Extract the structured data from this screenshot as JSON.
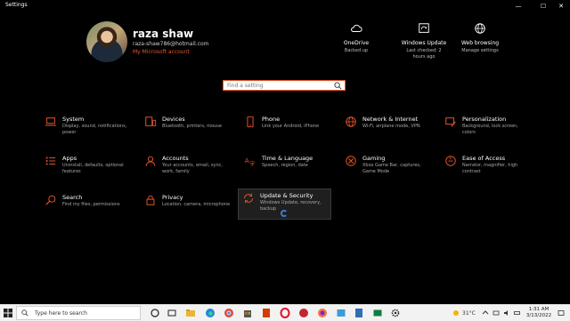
{
  "window": {
    "title": "Settings",
    "controls": {
      "minimize": "—",
      "maximize": "☐",
      "close": "✕"
    }
  },
  "profile": {
    "name": "raza shaw",
    "email": "raza-shaw786@hotmail.com",
    "account_link": "My Microsoft account"
  },
  "quick_links": [
    {
      "icon": "cloud-icon",
      "title": "OneDrive",
      "subtitle": "Backed up",
      "subtitle2": ""
    },
    {
      "icon": "windows-update-icon",
      "title": "Windows Update",
      "subtitle": "Last checked: 2",
      "subtitle2": "hours ago"
    },
    {
      "icon": "globe-icon",
      "title": "Web browsing",
      "subtitle": "Manage settings",
      "subtitle2": ""
    }
  ],
  "search": {
    "placeholder": "Find a setting"
  },
  "categories": [
    {
      "icon": "laptop-icon",
      "title": "System",
      "desc": "Display, sound, notifications, power"
    },
    {
      "icon": "devices-icon",
      "title": "Devices",
      "desc": "Bluetooth, printers, mouse"
    },
    {
      "icon": "phone-icon",
      "title": "Phone",
      "desc": "Link your Android, iPhone"
    },
    {
      "icon": "globe-icon",
      "title": "Network & Internet",
      "desc": "Wi-Fi, airplane mode, VPN"
    },
    {
      "icon": "paintbrush-icon",
      "title": "Personalization",
      "desc": "Background, lock screen, colors"
    },
    {
      "icon": "apps-list-icon",
      "title": "Apps",
      "desc": "Uninstall, defaults, optional features"
    },
    {
      "icon": "person-icon",
      "title": "Accounts",
      "desc": "Your accounts, email, sync, work, family"
    },
    {
      "icon": "time-language-icon",
      "title": "Time & Language",
      "desc": "Speech, region, date"
    },
    {
      "icon": "gamepad-icon",
      "title": "Gaming",
      "desc": "Xbox Game Bar, captures, Game Mode"
    },
    {
      "icon": "ease-of-access-icon",
      "title": "Ease of Access",
      "desc": "Narrator, magnifier, high contrast"
    },
    {
      "icon": "search-icon",
      "title": "Search",
      "desc": "Find my files, permissions"
    },
    {
      "icon": "lock-icon",
      "title": "Privacy",
      "desc": "Location, camera, microphone"
    },
    {
      "icon": "sync-icon",
      "title": "Update & Security",
      "desc": "Windows Update, recovery, backup"
    }
  ],
  "taskbar": {
    "search_placeholder": "Type here to search",
    "temperature": "31°C",
    "time": "1:31 AM",
    "date": "3/13/2022"
  },
  "colors": {
    "accent": "#e8562a",
    "background": "#000000",
    "taskbar": "#f2f2f2"
  }
}
